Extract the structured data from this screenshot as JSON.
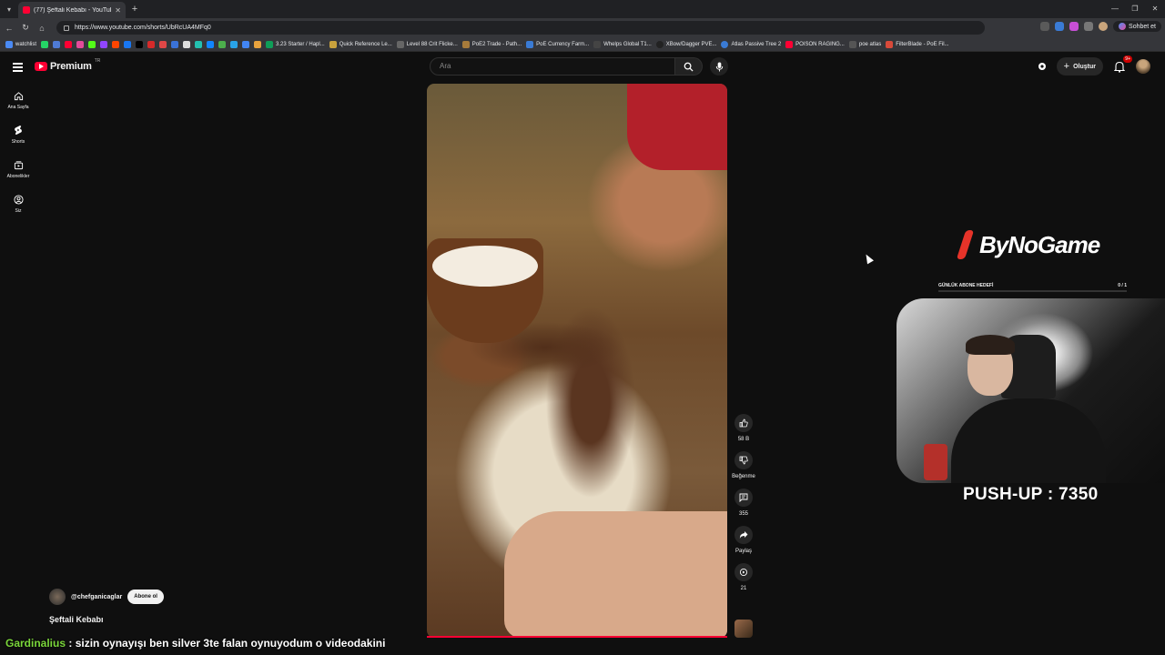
{
  "browser": {
    "tab_title": "(77) Şeftali Kebabı - YouTube",
    "url": "https://www.youtube.com/shorts/UbRcUA4MFq0",
    "chat_label": "Sohbet et",
    "bookmarks": [
      "watchlist",
      "3.23 Starter / Hapl...",
      "Quick Reference Le...",
      "Level 88 Crit Flicke...",
      "PoE2 Trade - Path...",
      "PoE Currency Farm...",
      "Whelps Global T1...",
      "XBow/Dagger PVE...",
      "Atlas Passive Tree 2",
      "POISON RAGING...",
      "poe atlas",
      "FilterBlade - PoE Fil..."
    ]
  },
  "youtube": {
    "logo_text": "Premium",
    "country_code": "TR",
    "search_placeholder": "Ara",
    "create_label": "Oluştur",
    "notif_count": "9+",
    "sidebar": [
      {
        "label": "Ana Sayfa",
        "icon": "home-icon"
      },
      {
        "label": "Shorts",
        "icon": "shorts-icon"
      },
      {
        "label": "Abonelikler",
        "icon": "subscriptions-icon"
      },
      {
        "label": "Siz",
        "icon": "you-icon"
      }
    ],
    "short": {
      "channel": "@chefganicaglar",
      "subscribe_label": "Abone ol",
      "title": "Şeftali Kebabı",
      "likes": "58 B",
      "dislike_label": "Beğenme",
      "comments": "355",
      "share_label": "Paylaş",
      "remix_count": "21"
    }
  },
  "overlay": {
    "brand": "ByNoGame",
    "goal_label": "GÜNLÜK ABONE HEDEFİ",
    "goal_value": "0 / 1",
    "pushup": "PUSH-UP : 7350",
    "chat_user": "Gardinalius",
    "chat_message": ": sizin oynayışı ben silver 3te falan oynuyodum o videodakini"
  },
  "colors": {
    "accent": "#ff0033",
    "brand_red": "#e63329",
    "chat_user": "#7ad63a"
  }
}
